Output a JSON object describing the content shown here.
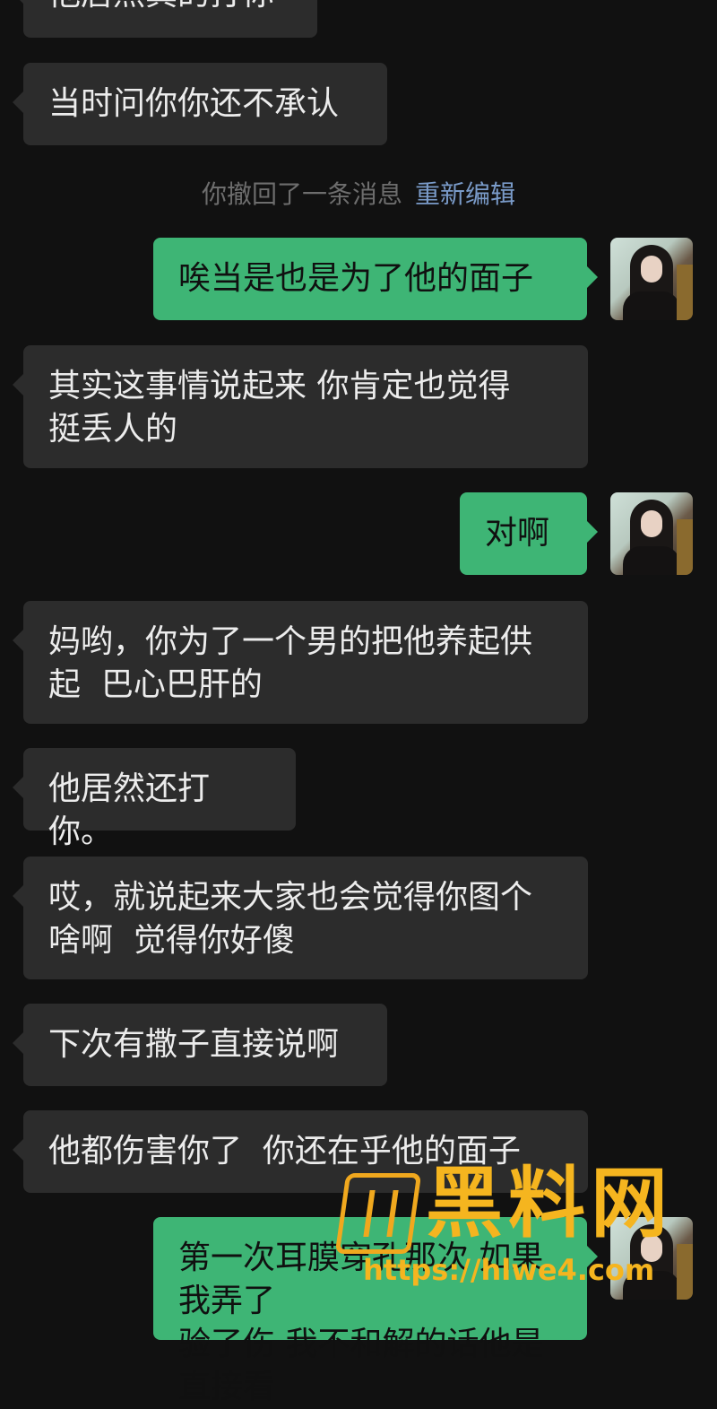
{
  "messages": [
    {
      "side": "left",
      "text": "他居然真的打你"
    },
    {
      "side": "left",
      "text": "当时问你你还不承认"
    },
    {
      "side": "system",
      "text": "你撤回了一条消息",
      "link": "重新编辑"
    },
    {
      "side": "right",
      "text": "唉当是也是为了他的面子"
    },
    {
      "side": "left",
      "text": "其实这事情说起来 你肯定也觉得\n挺丢人的"
    },
    {
      "side": "right",
      "text": "对啊"
    },
    {
      "side": "left",
      "text": "妈哟，你为了一个男的把他养起供\n起  巴心巴肝的"
    },
    {
      "side": "left",
      "text": "他居然还打你。"
    },
    {
      "side": "left",
      "text": "哎，就说起来大家也会觉得你图个\n啥啊  觉得你好傻"
    },
    {
      "side": "left",
      "text": "下次有撒子直接说啊"
    },
    {
      "side": "left",
      "text": "他都伤害你了  你还在乎他的面子"
    },
    {
      "side": "right",
      "text": "第一次耳膜穿孔那次 如果我弄了\n验了伤 我不和解的话他是直接看"
    }
  ],
  "colors": {
    "background": "#111111",
    "incoming_bubble": "#2c2c2c",
    "outgoing_bubble": "#3eb575",
    "system_link": "#7a9bc9",
    "watermark": "#f5b51f"
  },
  "avatar": {
    "icon": "user-avatar-photo"
  },
  "watermark": {
    "brand": "黑料网",
    "url": "https://hlwe4.com"
  }
}
